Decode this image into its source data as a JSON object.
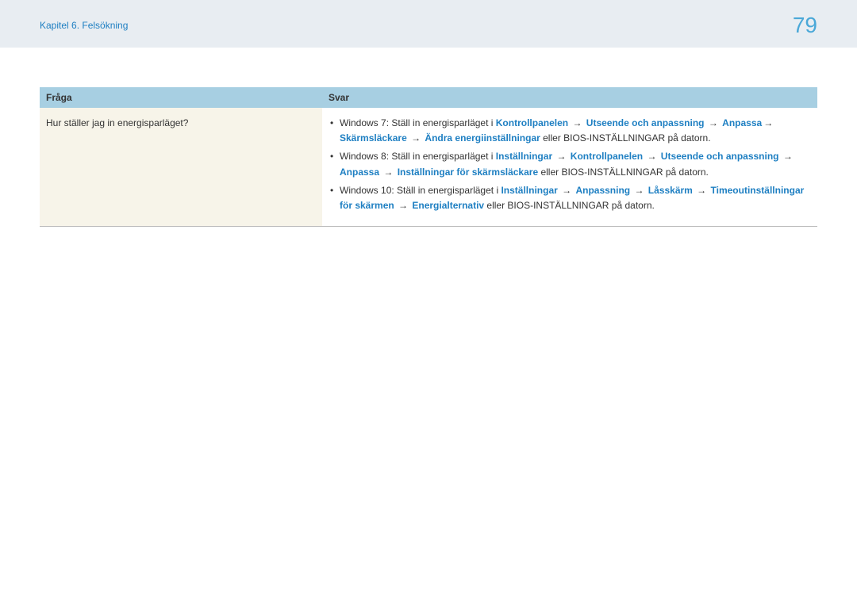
{
  "header": {
    "chapter": "Kapitel 6. Felsökning",
    "page_number": "79"
  },
  "table": {
    "col_question": "Fråga",
    "col_answer": "Svar",
    "question": "Hur ställer jag in energisparläget?",
    "answers": {
      "w7_intro": "Windows 7: Ställ in energisparläget i ",
      "w7_p1": "Kontrollpanelen",
      "w7_p2": "Utseende och anpassning",
      "w7_p3": "Anpassa",
      "w7_p4": "Skärmsläckare",
      "w7_p5": "Ändra energiinställningar",
      "w7_suffix": " eller BIOS-INSTÄLLNINGAR på datorn.",
      "w8_intro": "Windows 8: Ställ in energisparläget i ",
      "w8_p1": "Inställningar",
      "w8_p2": "Kontrollpanelen",
      "w8_p3": "Utseende och anpassning",
      "w8_p4": "Anpassa",
      "w8_p5": "Inställningar för skärmsläckare",
      "w8_suffix": " eller BIOS-INSTÄLLNINGAR på datorn.",
      "w10_intro": "Windows 10: Ställ in energisparläget i ",
      "w10_p1": "Inställningar",
      "w10_p2": "Anpassning",
      "w10_p3": "Låsskärm",
      "w10_p4": "Timeoutinställningar för skärmen",
      "w10_p5": "Energialternativ",
      "w10_suffix": " eller BIOS-INSTÄLLNINGAR på datorn."
    }
  }
}
